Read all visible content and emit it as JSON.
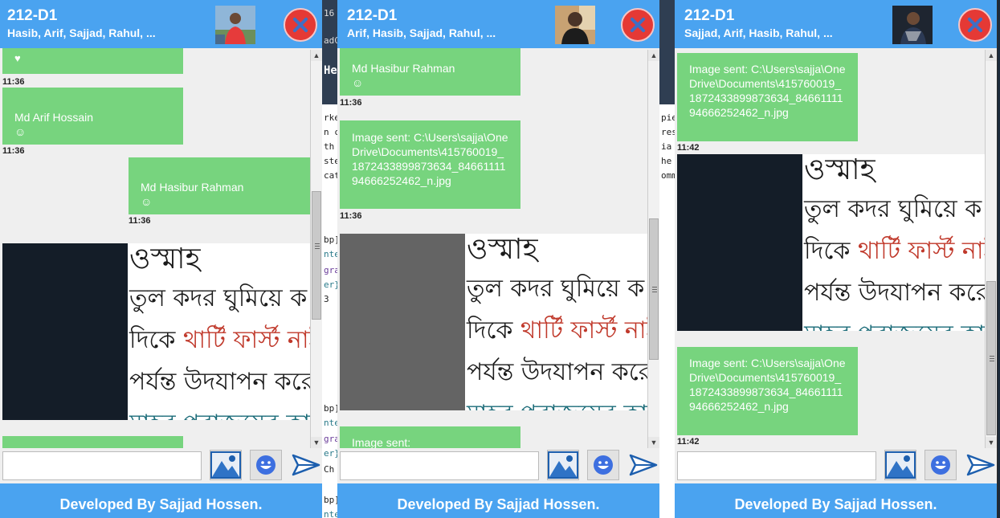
{
  "windows": [
    {
      "title": "212-D1",
      "members": "Hasib, Arif, Sajjad, Rahul, ...",
      "messages": [
        {
          "sender": "",
          "body": "♥",
          "time": "11:36"
        },
        {
          "sender": "Md Arif Hossain",
          "body": "☺",
          "time": "11:36"
        },
        {
          "sender": "Md Hasibur Rahman",
          "body": "☺",
          "time": "11:36"
        }
      ],
      "partial_bubble": "",
      "input_value": "",
      "footer": "Developed By Sajjad Hossen."
    },
    {
      "title": "212-D1",
      "members": "Arif, Hasib, Sajjad, Rahul, ...",
      "messages": [
        {
          "sender": "Md Hasibur Rahman",
          "body": "☺",
          "time": "11:36"
        },
        {
          "sender": "",
          "body": "Image sent: C:\\Users\\sajja\\OneDrive\\Documents\\415760019_1872433899873634_8466111194666252462_n.jpg",
          "time": "11:36"
        }
      ],
      "partial_bubble": "Image sent:",
      "input_value": "",
      "footer": "Developed By Sajjad Hossen."
    },
    {
      "title": "212-D1",
      "members": "Sajjad, Arif, Hasib, Rahul, ...",
      "messages": [
        {
          "sender": "",
          "body": "Image sent: C:\\Users\\sajja\\OneDrive\\Documents\\415760019_1872433899873634_8466111194666252462_n.jpg",
          "time": "11:42"
        },
        {
          "sender": "",
          "body": "Image sent: C:\\Users\\sajja\\OneDrive\\Documents\\415760019_1872433899873634_8466111194666252462_n.jpg",
          "time": "11:42"
        }
      ],
      "partial_bubble": "",
      "input_value": "",
      "footer": "Developed By Sajjad Hossen."
    }
  ],
  "shared_image": {
    "lines": [
      "ওস্মাহ",
      "তুল কদর ঘুমিয়ে ক",
      "দিকে থার্টি ফার্স্ট নাই",
      "পর্যন্ত উদযাপন করে",
      "মাহর পরাজয়ের কা"
    ],
    "highlight": "থার্টি ফার্স্ট নাই"
  },
  "background": {
    "code_a": [
      "16",
      "adC",
      "He",
      "rke",
      "n c",
      " th",
      "ste",
      "cat",
      "bp]",
      "nte",
      "gra",
      "er}",
      " 3",
      "bp]",
      "nte",
      "gra",
      "er}",
      " Ch",
      "bp]",
      "nte"
    ],
    "code_b": [
      "pie",
      "res",
      "ia",
      "he",
      "omm"
    ]
  },
  "colors": {
    "header": "#4aa3f0",
    "bubble": "#77d47e",
    "close": "#e53935",
    "highlight_text": "#c0392b",
    "teal_text": "#1a6b78"
  }
}
